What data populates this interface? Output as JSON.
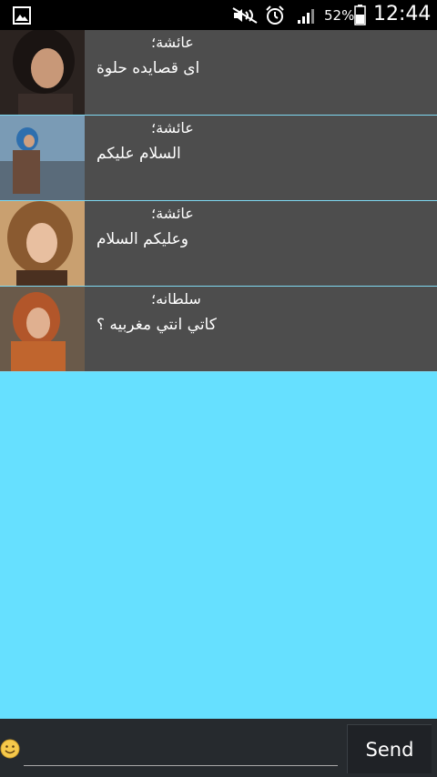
{
  "status_bar": {
    "battery_percent": "52%",
    "time": "12:44",
    "icons": [
      "gallery-icon",
      "mute-icon",
      "alarm-icon",
      "signal-icon",
      "battery-icon"
    ]
  },
  "messages": [
    {
      "sender": "عائشة؛",
      "text": "اى قصايده حلوة",
      "avatar": "avatar-photo"
    },
    {
      "sender": "عائشة؛",
      "text": "السلام عليكم",
      "avatar": "avatar-photo"
    },
    {
      "sender": "عائشة؛",
      "text": "وعليكم السلام",
      "avatar": "avatar-photo"
    },
    {
      "sender": "سلطانه؛",
      "text": "كاتي انتي مغربيه ؟",
      "avatar": "avatar-photo"
    }
  ],
  "composer": {
    "input_value": "",
    "input_placeholder": "",
    "send_label": "Send"
  },
  "colors": {
    "list_background": "#66e0ff",
    "row_background": "#4d4d4d",
    "status_bar": "#000000",
    "composer_background": "#262a2e"
  }
}
